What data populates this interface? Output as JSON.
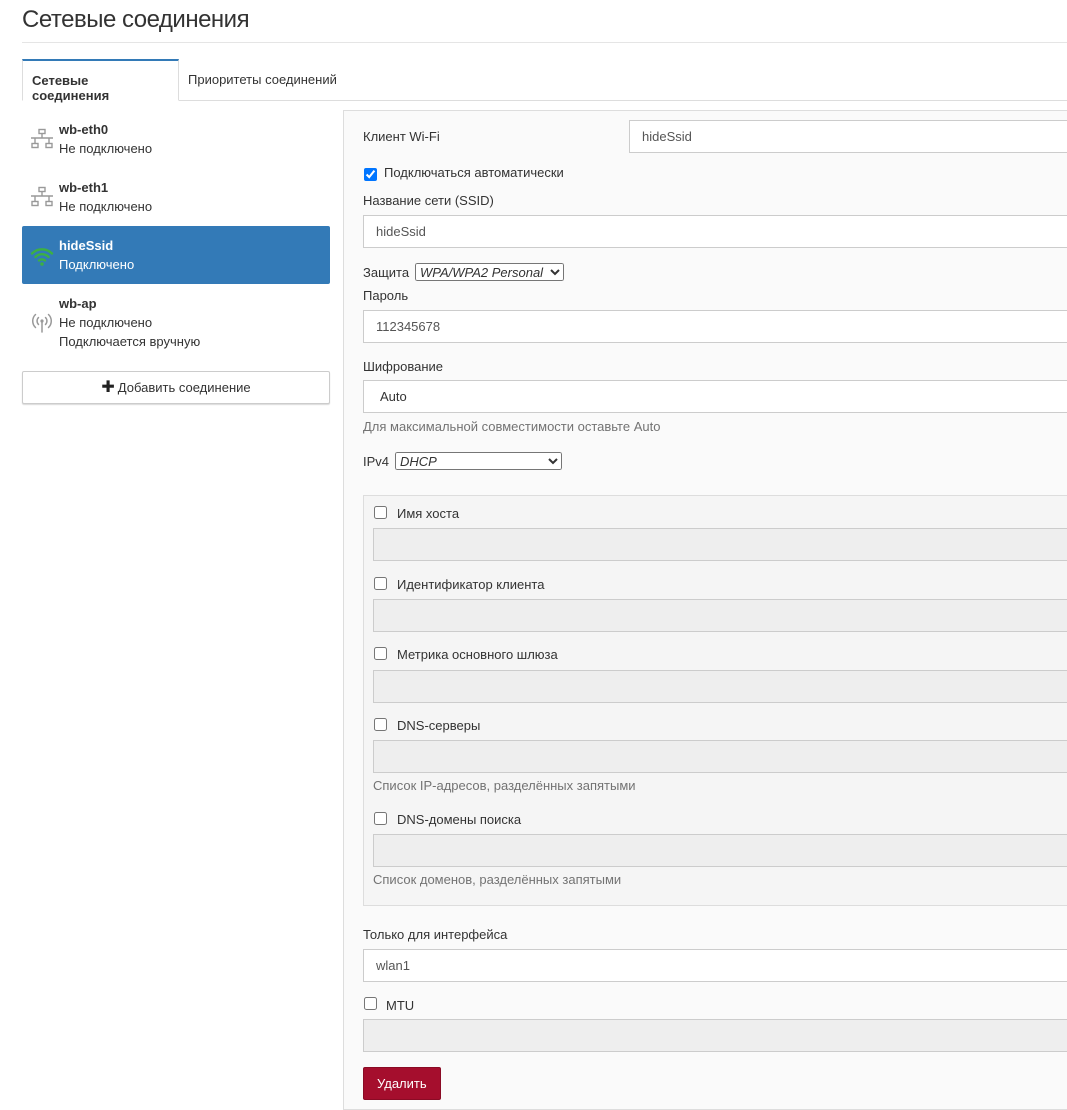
{
  "header": {
    "title": "Сетевые соединения"
  },
  "tabs": [
    {
      "label": "Сетевые соединения"
    },
    {
      "label": "Приоритеты соединений"
    }
  ],
  "connections": [
    {
      "name": "wb-eth0",
      "status": "Не подключено",
      "icon": "ethernet-icon"
    },
    {
      "name": "wb-eth1",
      "status": "Не подключено",
      "icon": "ethernet-icon"
    },
    {
      "name": "hideSsid",
      "status": "Подключено",
      "icon": "wifi-icon"
    },
    {
      "name": "wb-ap",
      "status": "Не подключено",
      "extra": "Подключается вручную",
      "icon": "access-point-icon"
    }
  ],
  "add_button": {
    "label": "Добавить соединение"
  },
  "form": {
    "type_label": "Клиент Wi-Fi",
    "type_value": "hideSsid",
    "autoconnect": {
      "label": "Подключаться автоматически",
      "checked": true
    },
    "ssid": {
      "label": "Название сети (SSID)",
      "value": "hideSsid"
    },
    "security": {
      "label": "Защита",
      "value": "WPA/WPA2 Personal"
    },
    "password": {
      "label": "Пароль",
      "value": "112345678"
    },
    "encryption": {
      "label": "Шифрование",
      "value": "Auto",
      "help": "Для максимальной совместимости оставьте Auto"
    },
    "ipv4": {
      "label": "IPv4",
      "value": "DHCP"
    },
    "dhcp": {
      "hostname": {
        "label": "Имя хоста"
      },
      "client_id": {
        "label": "Идентификатор клиента"
      },
      "metric": {
        "label": "Метрика основного шлюза"
      },
      "dns": {
        "label": "DNS-серверы",
        "help": "Список IP-адресов, разделённых запятыми"
      },
      "dns_search": {
        "label": "DNS-домены поиска",
        "help": "Список доменов, разделённых запятыми"
      }
    },
    "interface": {
      "label": "Только для интерфейса",
      "value": "wlan1"
    },
    "mtu": {
      "label": "MTU"
    },
    "delete_button": "Удалить"
  },
  "colors": {
    "accent": "#337ab7",
    "danger": "#a50e2d",
    "wifi": "#3cb043"
  }
}
